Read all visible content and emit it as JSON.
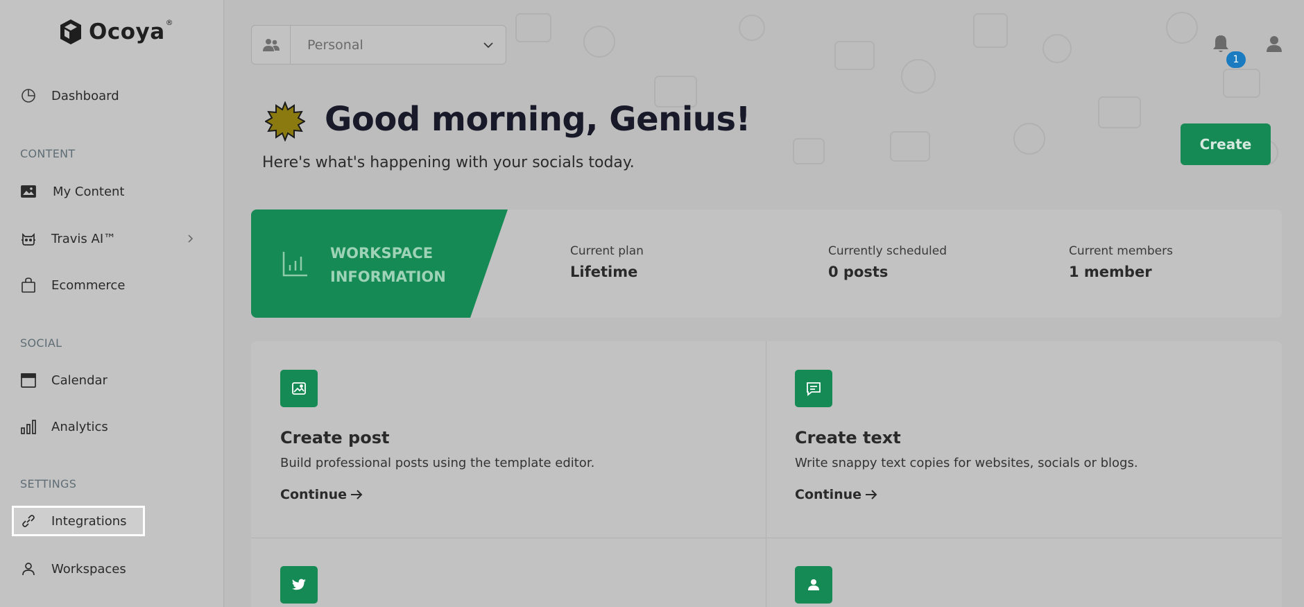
{
  "brand": {
    "name": "Ocoya",
    "reg": "®"
  },
  "sidebar": {
    "dashboard": "Dashboard",
    "sections": {
      "content": "CONTENT",
      "social": "SOCIAL",
      "settings": "SETTINGS"
    },
    "items": {
      "my_content": "My Content",
      "travis_ai": "Travis AI™",
      "ecommerce": "Ecommerce",
      "calendar": "Calendar",
      "analytics": "Analytics",
      "integrations": "Integrations",
      "workspaces": "Workspaces"
    }
  },
  "header": {
    "workspace_selected": "Personal",
    "notification_count": "1"
  },
  "hero": {
    "greeting": "Good morning, Genius!",
    "subtitle": "Here's what's happening with your socials today.",
    "create_label": "Create"
  },
  "workspace_info": {
    "title_line1": "WORKSPACE",
    "title_line2": "INFORMATION",
    "plan_label": "Current plan",
    "plan_value": "Lifetime",
    "scheduled_label": "Currently scheduled",
    "scheduled_value": "0 posts",
    "members_label": "Current members",
    "members_value": "1 member"
  },
  "tiles": [
    {
      "title": "Create post",
      "desc": "Build professional posts using the template editor.",
      "link": "Continue"
    },
    {
      "title": "Create text",
      "desc": "Write snappy text copies for websites, socials or blogs.",
      "link": "Continue"
    }
  ],
  "colors": {
    "accent": "#168a55",
    "badge": "#1a7bc1",
    "overlay": "#bdbdbd"
  }
}
